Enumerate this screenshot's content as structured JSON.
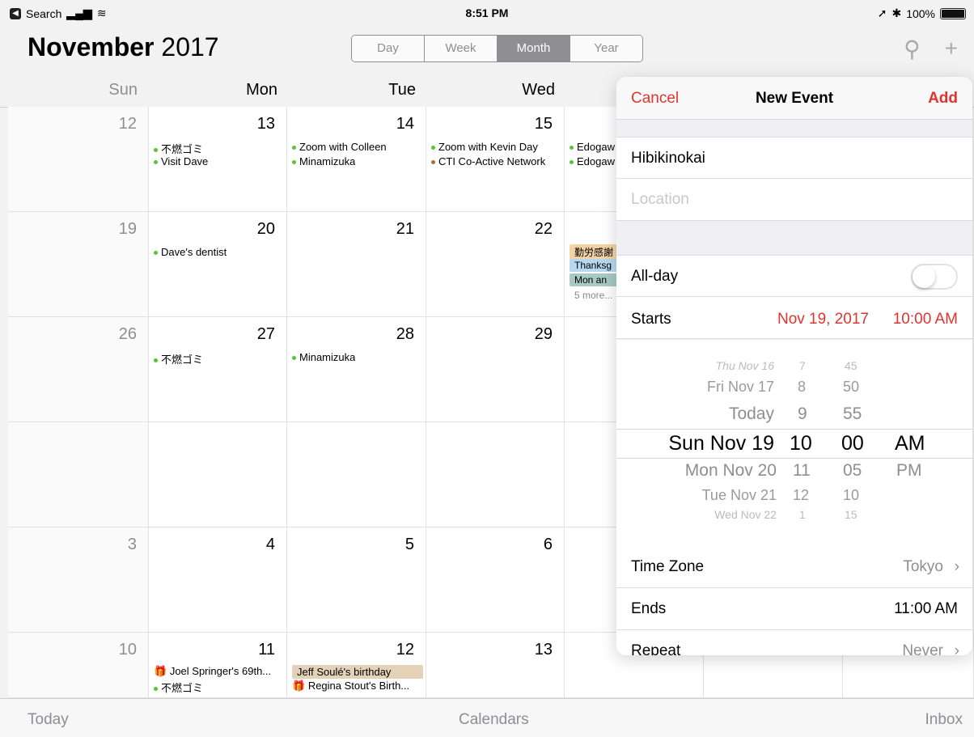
{
  "status_bar": {
    "back_label": "Search",
    "time": "8:51 PM",
    "battery": "100%"
  },
  "header": {
    "month": "November",
    "year": "2017"
  },
  "view_segments": [
    {
      "label": "Day",
      "active": false
    },
    {
      "label": "Week",
      "active": false
    },
    {
      "label": "Month",
      "active": true
    },
    {
      "label": "Year",
      "active": false
    }
  ],
  "weekdays": [
    "Sun",
    "Mon",
    "Tue",
    "Wed"
  ],
  "weeks": [
    {
      "sun": "12",
      "mon": "13",
      "tue": "14",
      "wed": "15"
    },
    {
      "sun": "19",
      "mon": "20",
      "tue": "21",
      "wed": "22"
    },
    {
      "sun": "26",
      "mon": "27",
      "tue": "28",
      "wed": "29"
    },
    {
      "sun": "",
      "mon": "",
      "tue": "",
      "wed": ""
    },
    {
      "sun": "3",
      "mon": "4",
      "tue": "5",
      "wed": "6"
    },
    {
      "sun": "10",
      "mon": "11",
      "tue": "12",
      "wed": "13"
    }
  ],
  "events": {
    "w0_mon": [
      "不燃ゴミ",
      "Visit Dave"
    ],
    "w0_tue": [
      "Zoom with Colleen",
      "Minamizuka"
    ],
    "w0_wed": [
      "Zoom with Kevin Day",
      "CTI Co-Active Network"
    ],
    "w0_thu": [
      "Edogaw",
      "Edogaw"
    ],
    "w1_mon": [
      "Dave's dentist"
    ],
    "w1_thu_chips": [
      "勤労感謝",
      "Thanksg",
      "Mon an"
    ],
    "w1_thu_more": "5 more...",
    "w2_mon": [
      "不燃ゴミ"
    ],
    "w2_tue": [
      "Minamizuka"
    ],
    "w5_mon": [
      "Joel Springer's 69th...",
      "不燃ゴミ"
    ],
    "w5_tue_chip": "Jeff Soulé's birthday",
    "w5_tue": [
      "Regina Stout's Birth..."
    ]
  },
  "toolbar": {
    "today": "Today",
    "calendars": "Calendars",
    "inbox": "Inbox"
  },
  "new_event": {
    "cancel": "Cancel",
    "title": "New Event",
    "add": "Add",
    "event_title": "Hibikinokai",
    "location_placeholder": "Location",
    "allday_label": "All-day",
    "allday_on": false,
    "starts_label": "Starts",
    "starts_date": "Nov 19, 2017",
    "starts_time": "10:00 AM",
    "timezone_label": "Time Zone",
    "timezone_value": "Tokyo",
    "ends_label": "Ends",
    "ends_value": "11:00 AM",
    "repeat_label": "Repeat",
    "repeat_value": "Never"
  },
  "picker": {
    "dates": [
      "Thu Nov 16",
      "Fri Nov 17",
      "Today",
      "Sun Nov 19",
      "Mon Nov 20",
      "Tue Nov 21",
      "Wed Nov 22"
    ],
    "hours": [
      "7",
      "8",
      "9",
      "10",
      "11",
      "12",
      "1"
    ],
    "minutes": [
      "45",
      "50",
      "55",
      "00",
      "05",
      "10",
      "15"
    ],
    "ampm": [
      "AM",
      "PM"
    ]
  },
  "colors": {
    "accent_red": "#e0342f",
    "event_green": "#5bc236",
    "event_brown": "#b06b3a"
  }
}
